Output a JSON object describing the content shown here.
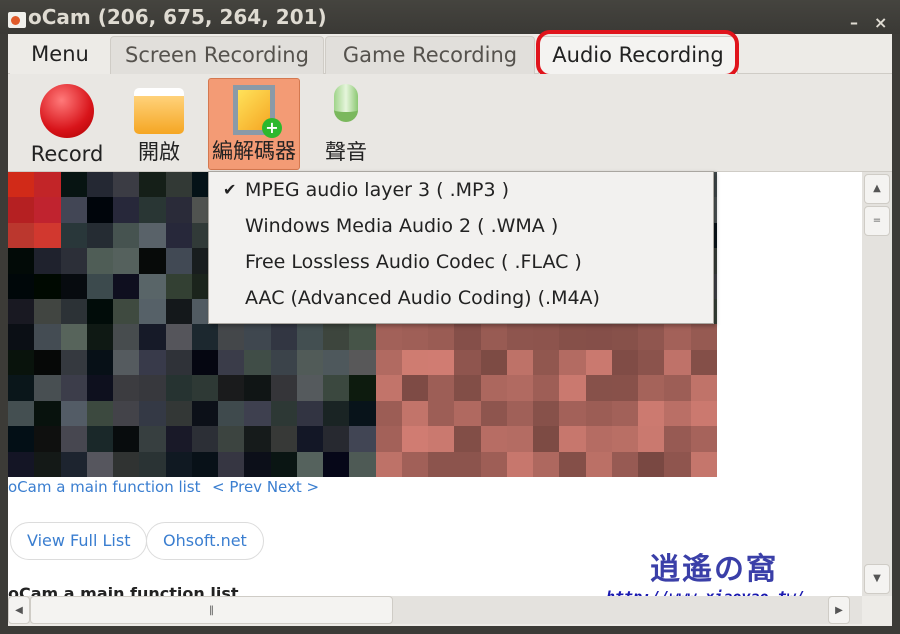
{
  "window": {
    "title": "oCam (206, 675, 264, 201)",
    "minimize": "–",
    "close": "×"
  },
  "tabs": [
    {
      "label": "Menu"
    },
    {
      "label": "Screen Recording"
    },
    {
      "label": "Game Recording"
    },
    {
      "label": "Audio Recording",
      "highlighted": true
    }
  ],
  "toolbar": [
    {
      "label": "Record",
      "icon": "record-icon"
    },
    {
      "label": "開啟",
      "icon": "folder-icon"
    },
    {
      "label": "編解碼器",
      "icon": "codec-film-icon",
      "active": true
    },
    {
      "label": "聲音",
      "icon": "microphone-icon"
    }
  ],
  "codec_menu": {
    "items": [
      {
        "label": "MPEG audio layer 3 ( .MP3 )",
        "checked": true
      },
      {
        "label": "Windows Media Audio 2 ( .WMA )"
      },
      {
        "label": "Free Lossless Audio Codec ( .FLAC )"
      },
      {
        "label": "AAC (Advanced Audio Coding) (.M4A)"
      }
    ],
    "check": "✔"
  },
  "content": {
    "link1": "oCam a main function list",
    "link2": "< Prev Next >",
    "btn1": "View Full List",
    "btn2": "Ohsoft.net",
    "heading": "oCam a main function list"
  },
  "watermark": {
    "logo": "逍遙の窩",
    "url": "http://www.xiaoyao.tw/"
  },
  "colors": {
    "highlight": "#e0141c",
    "link": "#3a7ed0",
    "active_tool": "#f39b75"
  }
}
